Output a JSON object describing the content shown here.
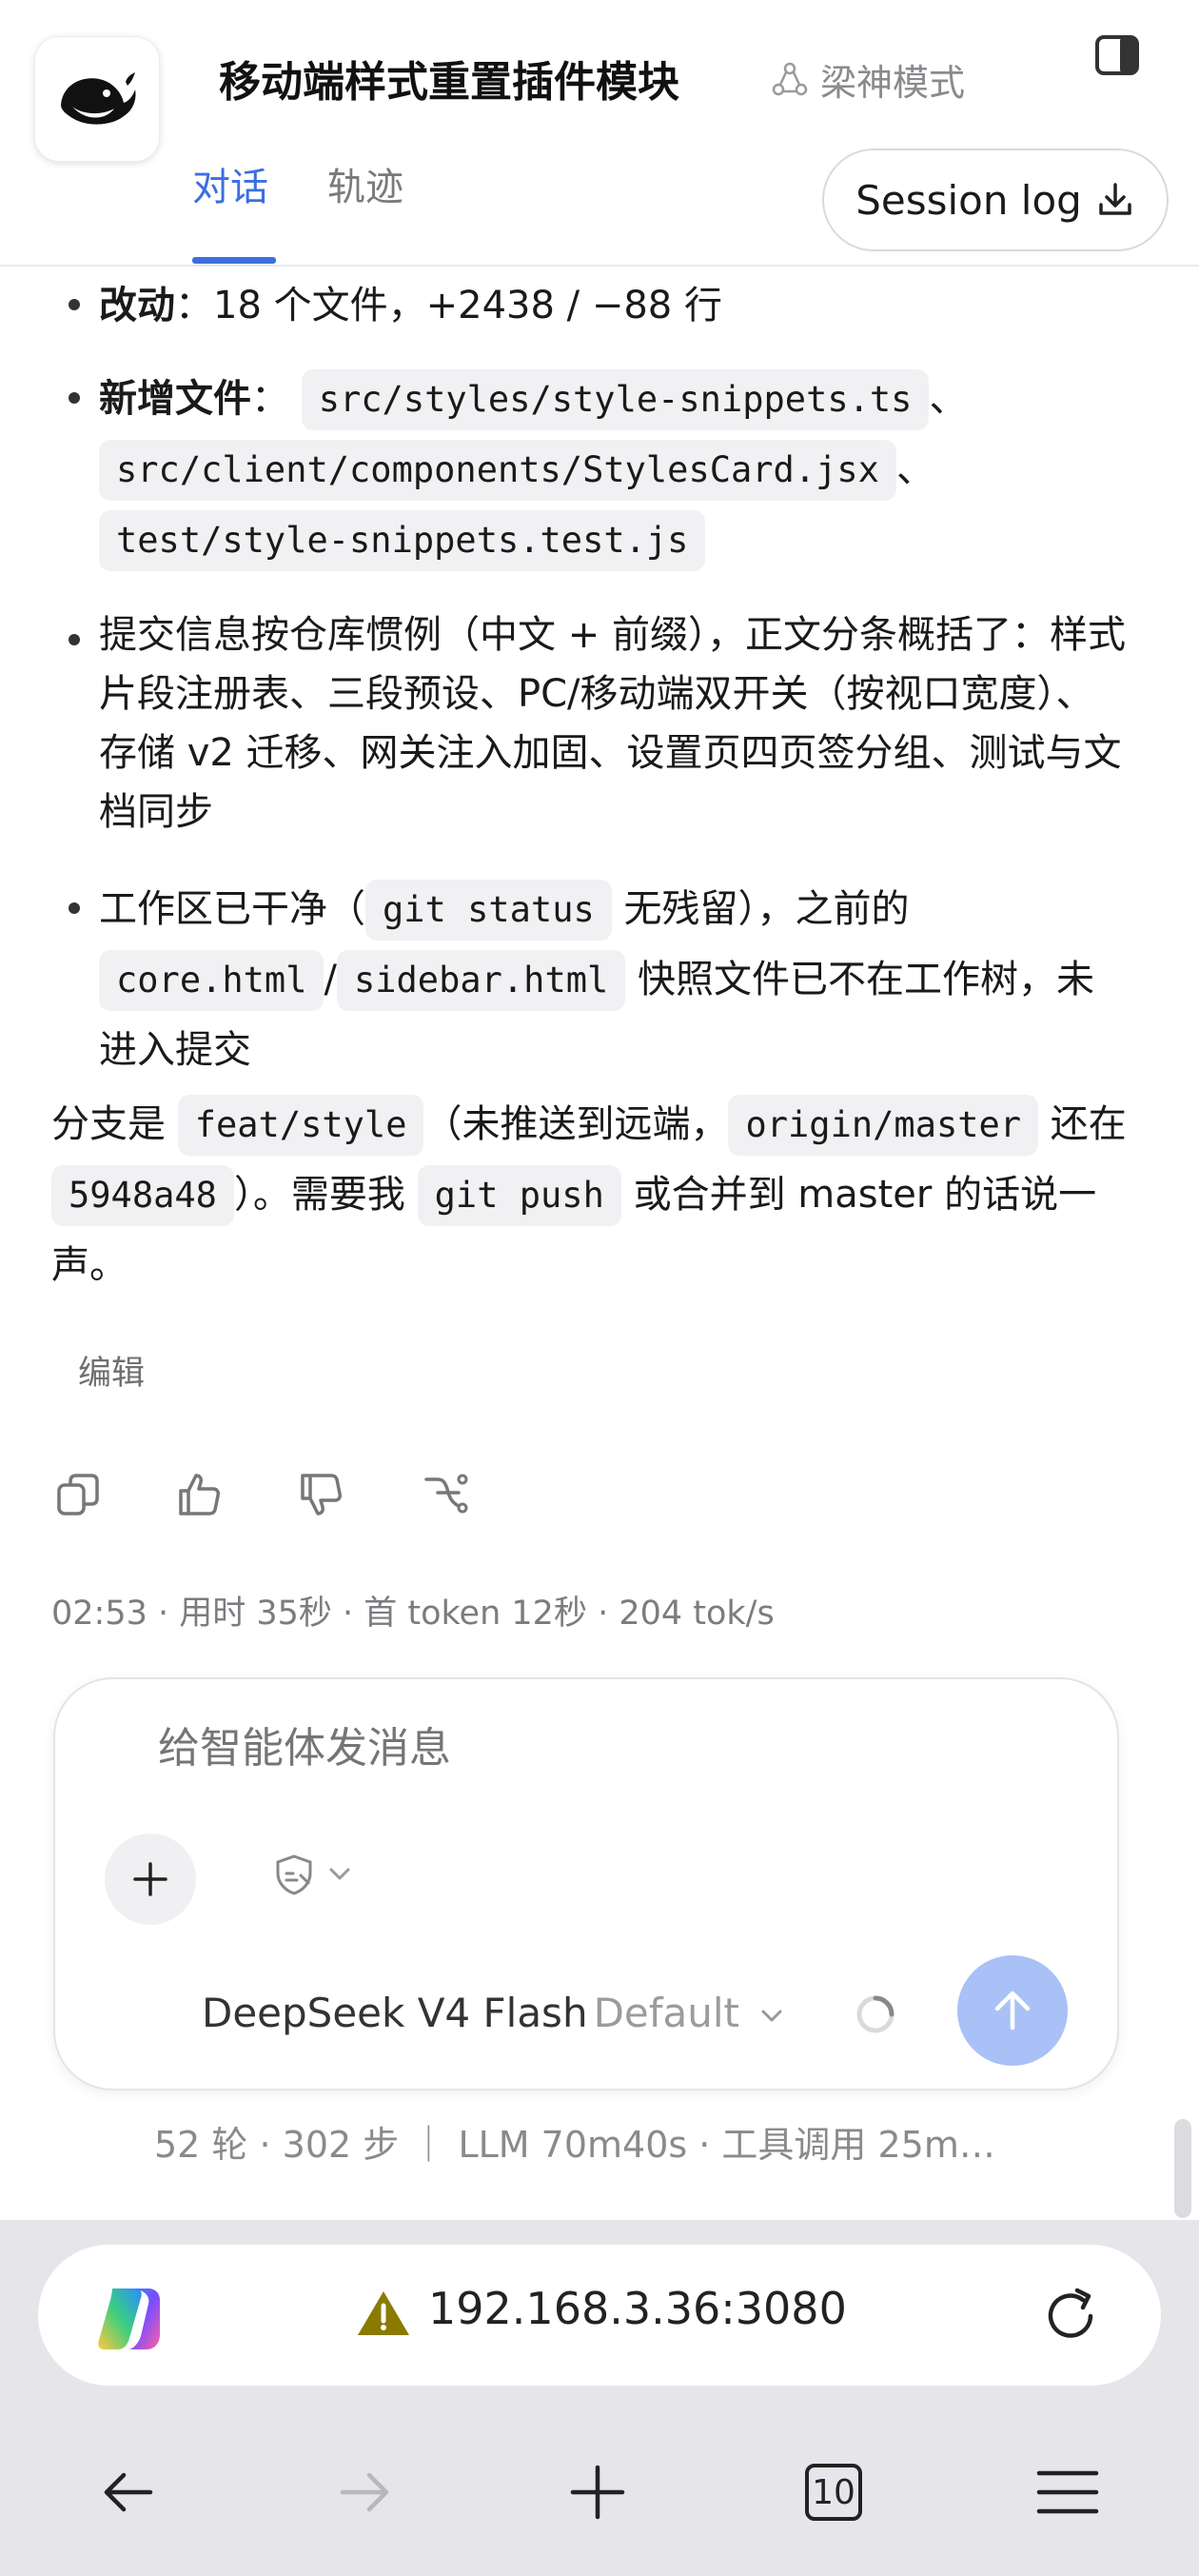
{
  "header": {
    "title": "移动端样式重置插件模块",
    "mode_label": "梁神模式",
    "tabs": [
      {
        "label": "对话",
        "active": true
      },
      {
        "label": "轨迹",
        "active": false
      }
    ],
    "session_log_label": "Session log"
  },
  "message": {
    "bullets": [
      {
        "bold": "改动",
        "text": "：18 个文件，+2438 / −88 行"
      },
      {
        "bold": "新增文件",
        "text": "：",
        "files": [
          "src/styles/style-snippets.ts",
          "src/client/components/StylesCard.jsx",
          "test/style-snippets.test.js"
        ],
        "sep": "、"
      },
      {
        "text": "提交信息按仓库惯例（中文 + 前缀），正文分条概括了：样式片段注册表、三段预设、PC/移动端双开关（按视口宽度）、存储 v2 迁移、网关注入加固、设置页四页签分组、测试与文档同步"
      },
      {
        "text_before": "工作区已干净（",
        "code1": "git status",
        "text_mid": " 无残留），之前的",
        "code2": "core.html",
        "slash": "/",
        "code3": "sidebar.html",
        "text_after": " 快照文件已不在工作树，未进入提交"
      }
    ],
    "closing": {
      "t1": "分支是 ",
      "c1": "feat/style",
      "t2": "（未推送到远端，",
      "c2": "origin/master",
      "t3": " 还在",
      "c3": "5948a48",
      "t4": "）。需要我 ",
      "c4": "git push",
      "t5": " 或合并到 master 的话说一",
      "t6": "声。"
    },
    "edit_label": "编辑",
    "meta": "02:53 · 用时 35秒 · 首 token 12秒 · 204 tok/s"
  },
  "composer": {
    "placeholder": "给智能体发消息",
    "model": "DeepSeek V4 Flash",
    "model_variant": "Default"
  },
  "stats": "52 轮 · 302 步  ｜  LLM 70m40s · 工具调用 25m…",
  "browser": {
    "url": "192.168.3.36:3080",
    "tab_count": "10"
  },
  "colors": {
    "accent": "#3b6fe0",
    "send_button": "#a9c1f6",
    "warning": "#8a7a00"
  }
}
